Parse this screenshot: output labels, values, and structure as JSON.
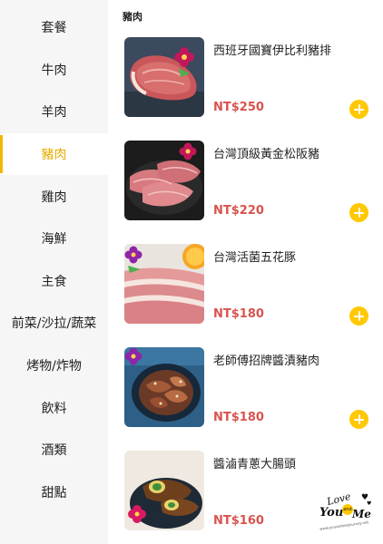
{
  "sidebar": {
    "items": [
      {
        "label": "套餐",
        "active": false
      },
      {
        "label": "牛肉",
        "active": false
      },
      {
        "label": "羊肉",
        "active": false
      },
      {
        "label": "豬肉",
        "active": true
      },
      {
        "label": "雞肉",
        "active": false
      },
      {
        "label": "海鮮",
        "active": false
      },
      {
        "label": "主食",
        "active": false
      },
      {
        "label": "前菜/沙拉/蔬菜",
        "active": false
      },
      {
        "label": "烤物/炸物",
        "active": false
      },
      {
        "label": "飲料",
        "active": false
      },
      {
        "label": "酒類",
        "active": false
      },
      {
        "label": "甜點",
        "active": false
      }
    ],
    "active_color": "#e6ac00"
  },
  "main": {
    "section_title": "豬肉",
    "products": [
      {
        "name": "西班牙國寶伊比利豬排",
        "price": "NT$250",
        "image": "iberico-pork-chop-photo"
      },
      {
        "name": "台灣頂級黃金松阪豬",
        "price": "NT$220",
        "image": "pork-jowl-slices-photo"
      },
      {
        "name": "台灣活菌五花豚",
        "price": "NT$180",
        "image": "pork-belly-slices-photo"
      },
      {
        "name": "老師傅招牌醬漬豬肉",
        "price": "NT$180",
        "image": "marinated-pork-bowl-photo"
      },
      {
        "name": "醬滷青蔥大腸頭",
        "price": "NT$160",
        "image": "braised-intestine-scallion-photo"
      }
    ],
    "price_color": "#d9534f",
    "add_button_color": "#ffc800",
    "add_icon": "plus-icon"
  },
  "watermark": {
    "love": "Love",
    "you": "You",
    "and": "and",
    "me": "Me",
    "url": "www.youandmejourney.net"
  }
}
